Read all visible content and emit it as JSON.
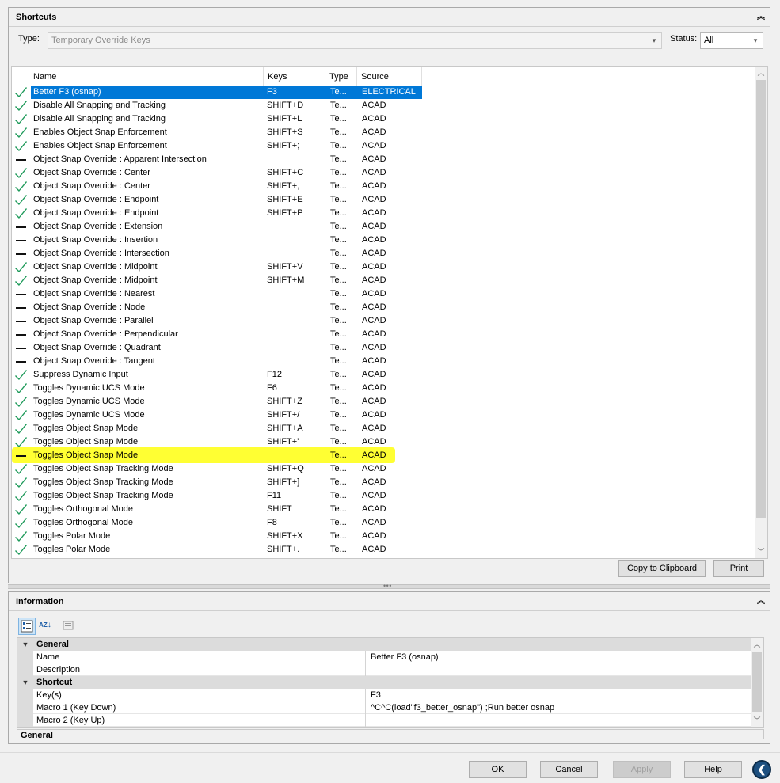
{
  "shortcuts_panel": {
    "title": "Shortcuts",
    "type_label": "Type:",
    "type_value": "Temporary Override Keys",
    "status_label": "Status:",
    "status_value": "All",
    "columns": {
      "name": "Name",
      "keys": "Keys",
      "type": "Type",
      "source": "Source"
    },
    "rows": [
      {
        "status": "check",
        "name": "Better F3 (osnap)",
        "keys": "F3",
        "type": "Te...",
        "source": "ELECTRICAL"
      },
      {
        "status": "check",
        "name": "Disable All Snapping and Tracking",
        "keys": "SHIFT+D",
        "type": "Te...",
        "source": "ACAD"
      },
      {
        "status": "check",
        "name": "Disable All Snapping and Tracking",
        "keys": "SHIFT+L",
        "type": "Te...",
        "source": "ACAD"
      },
      {
        "status": "check",
        "name": "Enables Object Snap Enforcement",
        "keys": "SHIFT+S",
        "type": "Te...",
        "source": "ACAD"
      },
      {
        "status": "check",
        "name": "Enables Object Snap Enforcement",
        "keys": "SHIFT+;",
        "type": "Te...",
        "source": "ACAD"
      },
      {
        "status": "dash",
        "name": "Object Snap Override : Apparent Intersection",
        "keys": "",
        "type": "Te...",
        "source": "ACAD"
      },
      {
        "status": "check",
        "name": "Object Snap Override : Center",
        "keys": "SHIFT+C",
        "type": "Te...",
        "source": "ACAD"
      },
      {
        "status": "check",
        "name": "Object Snap Override : Center",
        "keys": "SHIFT+,",
        "type": "Te...",
        "source": "ACAD"
      },
      {
        "status": "check",
        "name": "Object Snap Override : Endpoint",
        "keys": "SHIFT+E",
        "type": "Te...",
        "source": "ACAD"
      },
      {
        "status": "check",
        "name": "Object Snap Override : Endpoint",
        "keys": "SHIFT+P",
        "type": "Te...",
        "source": "ACAD"
      },
      {
        "status": "dash",
        "name": "Object Snap Override : Extension",
        "keys": "",
        "type": "Te...",
        "source": "ACAD"
      },
      {
        "status": "dash",
        "name": "Object Snap Override : Insertion",
        "keys": "",
        "type": "Te...",
        "source": "ACAD"
      },
      {
        "status": "dash",
        "name": "Object Snap Override : Intersection",
        "keys": "",
        "type": "Te...",
        "source": "ACAD"
      },
      {
        "status": "check",
        "name": "Object Snap Override : Midpoint",
        "keys": "SHIFT+V",
        "type": "Te...",
        "source": "ACAD"
      },
      {
        "status": "check",
        "name": "Object Snap Override : Midpoint",
        "keys": "SHIFT+M",
        "type": "Te...",
        "source": "ACAD"
      },
      {
        "status": "dash",
        "name": "Object Snap Override : Nearest",
        "keys": "",
        "type": "Te...",
        "source": "ACAD"
      },
      {
        "status": "dash",
        "name": "Object Snap Override : Node",
        "keys": "",
        "type": "Te...",
        "source": "ACAD"
      },
      {
        "status": "dash",
        "name": "Object Snap Override : Parallel",
        "keys": "",
        "type": "Te...",
        "source": "ACAD"
      },
      {
        "status": "dash",
        "name": "Object Snap Override : Perpendicular",
        "keys": "",
        "type": "Te...",
        "source": "ACAD"
      },
      {
        "status": "dash",
        "name": "Object Snap Override : Quadrant",
        "keys": "",
        "type": "Te...",
        "source": "ACAD"
      },
      {
        "status": "dash",
        "name": "Object Snap Override : Tangent",
        "keys": "",
        "type": "Te...",
        "source": "ACAD"
      },
      {
        "status": "check",
        "name": "Suppress Dynamic Input",
        "keys": "F12",
        "type": "Te...",
        "source": "ACAD"
      },
      {
        "status": "check",
        "name": "Toggles Dynamic UCS Mode",
        "keys": "F6",
        "type": "Te...",
        "source": "ACAD"
      },
      {
        "status": "check",
        "name": "Toggles Dynamic UCS Mode",
        "keys": "SHIFT+Z",
        "type": "Te...",
        "source": "ACAD"
      },
      {
        "status": "check",
        "name": "Toggles Dynamic UCS Mode",
        "keys": "SHIFT+/",
        "type": "Te...",
        "source": "ACAD"
      },
      {
        "status": "check",
        "name": "Toggles Object Snap Mode",
        "keys": "SHIFT+A",
        "type": "Te...",
        "source": "ACAD"
      },
      {
        "status": "check",
        "name": "Toggles Object Snap Mode",
        "keys": "SHIFT+'",
        "type": "Te...",
        "source": "ACAD"
      },
      {
        "status": "dash",
        "name": "Toggles Object Snap Mode",
        "keys": "",
        "type": "Te...",
        "source": "ACAD"
      },
      {
        "status": "check",
        "name": "Toggles Object Snap Tracking Mode",
        "keys": "SHIFT+Q",
        "type": "Te...",
        "source": "ACAD"
      },
      {
        "status": "check",
        "name": "Toggles Object Snap Tracking Mode",
        "keys": "SHIFT+]",
        "type": "Te...",
        "source": "ACAD"
      },
      {
        "status": "check",
        "name": "Toggles Object Snap Tracking Mode",
        "keys": "F11",
        "type": "Te...",
        "source": "ACAD"
      },
      {
        "status": "check",
        "name": "Toggles Orthogonal Mode",
        "keys": "SHIFT",
        "type": "Te...",
        "source": "ACAD"
      },
      {
        "status": "check",
        "name": "Toggles Orthogonal Mode",
        "keys": "F8",
        "type": "Te...",
        "source": "ACAD"
      },
      {
        "status": "check",
        "name": "Toggles Polar Mode",
        "keys": "SHIFT+X",
        "type": "Te...",
        "source": "ACAD"
      },
      {
        "status": "check",
        "name": "Toggles Polar Mode",
        "keys": "SHIFT+.",
        "type": "Te...",
        "source": "ACAD"
      }
    ],
    "selected_row": 0,
    "highlighted_row": 27,
    "copy_button": "Copy to Clipboard",
    "print_button": "Print"
  },
  "information_panel": {
    "title": "Information",
    "toolbar": [
      "categorized-icon",
      "alphabetical-sort-icon",
      "property-pages-icon"
    ],
    "sort_az_glyph": "AZ",
    "categories": [
      {
        "label": "General",
        "props": [
          {
            "name": "Name",
            "value": "Better F3 (osnap)"
          },
          {
            "name": "Description",
            "value": ""
          }
        ]
      },
      {
        "label": "Shortcut",
        "props": [
          {
            "name": "Key(s)",
            "value": "F3"
          },
          {
            "name": "Macro 1 (Key Down)",
            "value": "^C^C(load\"f3_better_osnap\") ;Run better osnap"
          },
          {
            "name": "Macro 2 (Key Up)",
            "value": ""
          }
        ]
      }
    ],
    "description_title": "General"
  },
  "dialog_buttons": {
    "ok": "OK",
    "cancel": "Cancel",
    "apply": "Apply",
    "help": "Help"
  },
  "colors": {
    "selection": "#0078d7",
    "check": "#1e9a5a",
    "highlight": "#ffff33"
  }
}
